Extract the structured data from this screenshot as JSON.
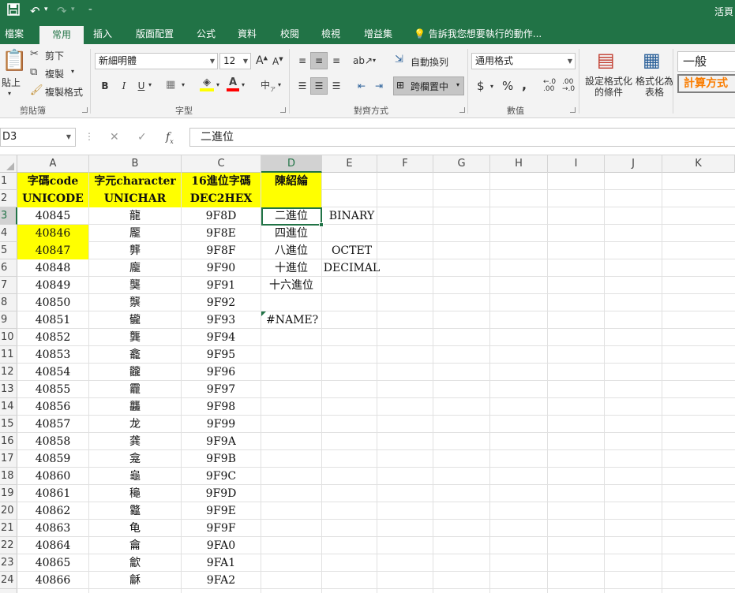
{
  "titlebar": {
    "right_text": "活頁"
  },
  "tabs": [
    {
      "label": "檔案",
      "active": false
    },
    {
      "label": "常用",
      "active": true
    },
    {
      "label": "插入",
      "active": false
    },
    {
      "label": "版面配置",
      "active": false
    },
    {
      "label": "公式",
      "active": false
    },
    {
      "label": "資料",
      "active": false
    },
    {
      "label": "校閱",
      "active": false
    },
    {
      "label": "檢視",
      "active": false
    },
    {
      "label": "增益集",
      "active": false
    }
  ],
  "tellme": "告訴我您想要執行的動作...",
  "ribbon": {
    "clipboard": {
      "paste": "貼上",
      "cut": "剪下",
      "copy": "複製",
      "format_painter": "複製格式",
      "label": "剪貼簿"
    },
    "font": {
      "name": "新細明體",
      "size": "12",
      "label": "字型",
      "bold": "B",
      "italic": "I",
      "underline": "U"
    },
    "alignment": {
      "wrap": "自動換列",
      "merge": "跨欄置中",
      "label": "對齊方式"
    },
    "number": {
      "format": "通用格式",
      "label": "數值",
      "currency": "$",
      "percent": "%",
      "comma": ","
    },
    "styles": {
      "conditional": "設定格式化的條件",
      "as_table": "格式化為表格",
      "normal": "一般",
      "calc": "計算方式"
    }
  },
  "namebox": "D3",
  "formula": "二進位",
  "columns": [
    "A",
    "B",
    "C",
    "D",
    "E",
    "F",
    "G",
    "H",
    "I",
    "J",
    "K"
  ],
  "selected_col": "D",
  "selected_row": 3,
  "rows": [
    [
      "字碼code",
      "字元character",
      "16進位字碼",
      "陳紹綸",
      ""
    ],
    [
      "UNICODE",
      "UNICHAR",
      "DEC2HEX",
      "",
      ""
    ],
    [
      "40845",
      "龍",
      "9F8D",
      "二進位",
      "BINARY"
    ],
    [
      "40846",
      "龎",
      "9F8E",
      "四進位",
      ""
    ],
    [
      "40847",
      "龏",
      "9F8F",
      "八進位",
      "OCTET"
    ],
    [
      "40848",
      "龐",
      "9F90",
      "十進位",
      "DECIMAL"
    ],
    [
      "40849",
      "龑",
      "9F91",
      "十六進位",
      ""
    ],
    [
      "40850",
      "龒",
      "9F92",
      "",
      ""
    ],
    [
      "40851",
      "龓",
      "9F93",
      "#NAME?",
      ""
    ],
    [
      "40852",
      "龔",
      "9F94",
      "",
      ""
    ],
    [
      "40853",
      "龕",
      "9F95",
      "",
      ""
    ],
    [
      "40854",
      "龖",
      "9F96",
      "",
      ""
    ],
    [
      "40855",
      "龗",
      "9F97",
      "",
      ""
    ],
    [
      "40856",
      "龘",
      "9F98",
      "",
      ""
    ],
    [
      "40857",
      "龙",
      "9F99",
      "",
      ""
    ],
    [
      "40858",
      "龚",
      "9F9A",
      "",
      ""
    ],
    [
      "40859",
      "龛",
      "9F9B",
      "",
      ""
    ],
    [
      "40860",
      "龜",
      "9F9C",
      "",
      ""
    ],
    [
      "40861",
      "龝",
      "9F9D",
      "",
      ""
    ],
    [
      "40862",
      "龞",
      "9F9E",
      "",
      ""
    ],
    [
      "40863",
      "龟",
      "9F9F",
      "",
      ""
    ],
    [
      "40864",
      "龠",
      "9FA0",
      "",
      ""
    ],
    [
      "40865",
      "龡",
      "9FA1",
      "",
      ""
    ],
    [
      "40866",
      "龢",
      "9FA2",
      "",
      ""
    ]
  ],
  "highlight": {
    "color": "#ffff00"
  },
  "accent": "#217346"
}
